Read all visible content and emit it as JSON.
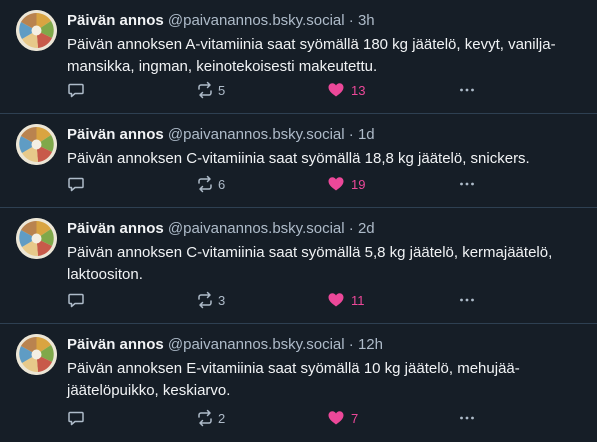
{
  "colors": {
    "background": "#161e27",
    "divider": "#2e4052",
    "text_primary": "#f1f3f5",
    "text_secondary": "#aebbc9",
    "like_active": "#ec4899"
  },
  "icons": {
    "reply": "speech-bubble-icon",
    "repost": "repost-arrows-icon",
    "like": "heart-filled-icon",
    "more": "ellipsis-icon"
  },
  "posts": [
    {
      "author": "Päivän annos",
      "handle": "@paivanannos.bsky.social",
      "separator": "·",
      "time": "3h",
      "text": "Päivän annoksen A-vitamiinia saat syömällä 180 kg jäätelö, kevyt, vanilja-mansikka, ingman, keinotekoisesti makeutettu.",
      "reposts": "5",
      "likes": "13"
    },
    {
      "author": "Päivän annos",
      "handle": "@paivanannos.bsky.social",
      "separator": "·",
      "time": "1d",
      "text": "Päivän annoksen C-vitamiinia saat syömällä 18,8 kg jäätelö, snickers.",
      "reposts": "6",
      "likes": "19"
    },
    {
      "author": "Päivän annos",
      "handle": "@paivanannos.bsky.social",
      "separator": "·",
      "time": "2d",
      "text": "Päivän annoksen C-vitamiinia saat syömällä 5,8 kg jäätelö, kermajäätelö, laktoositon.",
      "reposts": "3",
      "likes": "11"
    },
    {
      "author": "Päivän annos",
      "handle": "@paivanannos.bsky.social",
      "separator": "·",
      "time": "12h",
      "text": "Päivän annoksen E-vitamiinia saat syömällä 10 kg jäätelö, mehujää-jäätelöpuikko, keskiarvo.",
      "reposts": "2",
      "likes": "7"
    }
  ]
}
